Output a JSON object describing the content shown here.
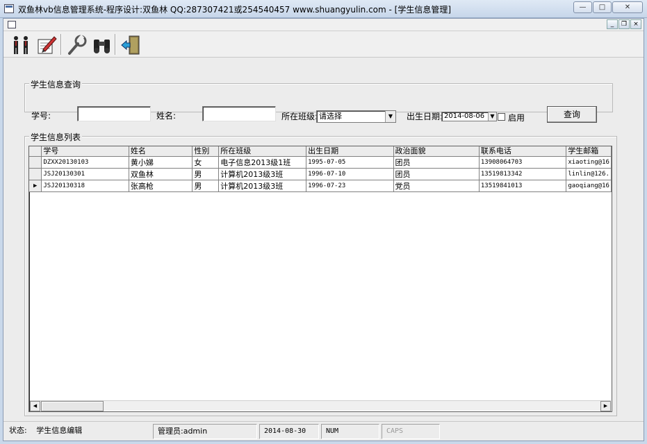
{
  "window": {
    "title": "双鱼林vb信息管理系统-程序设计:双鱼林 QQ:287307421或254540457 www.shuangyulin.com - [学生信息管理]",
    "minimize": "—",
    "maximize": "□",
    "close": "✕"
  },
  "mdi": {
    "minimize": "_",
    "restore": "❐",
    "close": "×"
  },
  "toolbar": {
    "icons": [
      "students-icon",
      "edit-document-icon",
      "tools-icon",
      "binoculars-icon",
      "exit-door-icon"
    ]
  },
  "query": {
    "group_label": "学生信息查询",
    "student_id_label": "学号:",
    "student_id_value": "",
    "name_label": "姓名:",
    "name_value": "",
    "class_label": "所在班级:",
    "class_value": "请选择",
    "birth_label": "出生日期:",
    "birth_value": "2014-08-06",
    "enable_label": "启用",
    "enable_checked": false,
    "search_button": "查询"
  },
  "list": {
    "group_label": "学生信息列表",
    "columns": [
      "学号",
      "姓名",
      "性别",
      "所在班级",
      "出生日期",
      "政治面貌",
      "联系电话",
      "学生邮箱"
    ],
    "rows": [
      [
        "DZXX20130103",
        "黄小娣",
        "女",
        "电子信息2013级1班",
        "1995-07-05",
        "团员",
        "13908064703",
        "xiaoting@16"
      ],
      [
        "JSJ20130301",
        "双鱼林",
        "男",
        "计算机2013级3班",
        "1996-07-10",
        "团员",
        "13519813342",
        "linlin@126."
      ],
      [
        "JSJ20130318",
        "张高枪",
        "男",
        "计算机2013级3班",
        "1996-07-23",
        "党员",
        "13519841013",
        "gaoqiang@16"
      ]
    ],
    "current_row_marker": "▶",
    "current_row": 2
  },
  "statusbar": {
    "status_label": "状态:",
    "status_value": "学生信息编辑",
    "admin": "管理员:admin",
    "date": "2014-08-30",
    "num": "NUM",
    "caps": "CAPS"
  }
}
